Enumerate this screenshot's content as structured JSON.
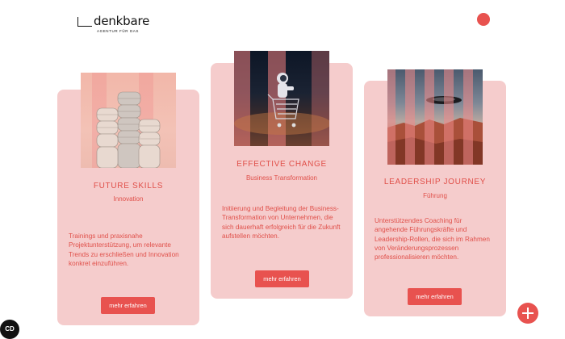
{
  "brand": {
    "logo_text": "denkbare",
    "tagline": "AGENTUR FÜR DAS"
  },
  "colors": {
    "accent": "#e8524f",
    "card": "#f5cccc",
    "text": "#e0504a"
  },
  "cards": [
    {
      "title": "FUTURE SKILLS",
      "subtitle": "Innovation",
      "description": "Trainings und praxisnahe Projektunterstützung, um relevante Trends zu erschließen und Innovation konkret einzuführen.",
      "button": "mehr erfahren",
      "image_icon": "stacked-towers-image"
    },
    {
      "title": "EFFECTIVE CHANGE",
      "subtitle": "Business Transformation",
      "description": "Initiierung und Begleitung der Business-Transformation von Unternehmen, die sich dauerhaft erfolgreich für die Zukunft aufstellen möchten.",
      "button": "mehr erfahren",
      "image_icon": "astronaut-shopping-cart-image"
    },
    {
      "title": "LEADERSHIP JOURNEY",
      "subtitle": "Führung",
      "description": "Unterstützendes Coaching für angehende Führungskräfte und Leadership-Rollen, die sich im Rahmen von Veränderungsprozessen professionalisieren möchten.",
      "button": "mehr erfahren",
      "image_icon": "desert-ufo-image"
    }
  ],
  "cookie_badge": "CD",
  "icons": {
    "menu": "menu-dot-icon",
    "fab": "plus-icon"
  }
}
